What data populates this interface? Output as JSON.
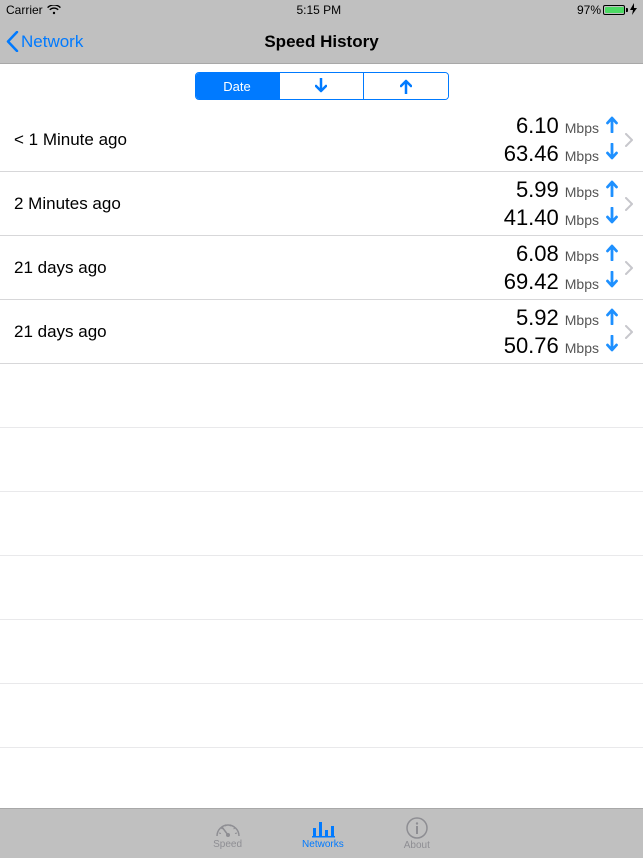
{
  "statusBar": {
    "carrier": "Carrier",
    "time": "5:15 PM",
    "batteryPct": "97%",
    "batteryFill": 97
  },
  "nav": {
    "back": "Network",
    "title": "Speed History"
  },
  "segments": {
    "date": "Date"
  },
  "unit": "Mbps",
  "rows": [
    {
      "time": "< 1 Minute ago",
      "up": "6.10",
      "down": "63.46"
    },
    {
      "time": "2 Minutes ago",
      "up": "5.99",
      "down": "41.40"
    },
    {
      "time": "21 days ago",
      "up": "6.08",
      "down": "69.42"
    },
    {
      "time": "21 days ago",
      "up": "5.92",
      "down": "50.76"
    }
  ],
  "tabs": {
    "speed": "Speed",
    "networks": "Networks",
    "about": "About"
  }
}
